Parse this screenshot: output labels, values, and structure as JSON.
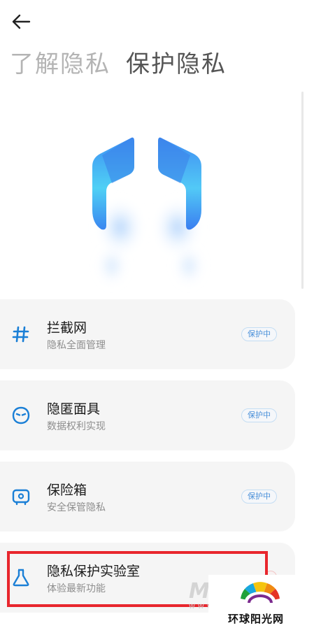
{
  "header": {
    "back_icon": "arrow-left-icon"
  },
  "tabs": [
    {
      "label": "了解隐私",
      "active": false
    },
    {
      "label": "保护隐私",
      "active": true
    }
  ],
  "hero": {
    "illustration": "privacy-shield-illustration"
  },
  "cards": [
    {
      "icon": "hash-icon",
      "title": "拦截网",
      "subtitle": "隐私全面管理",
      "badge": "保护中"
    },
    {
      "icon": "mask-icon",
      "title": "隐匿面具",
      "subtitle": "数据权利实现",
      "badge": "保护中"
    },
    {
      "icon": "safe-box-icon",
      "title": "保险箱",
      "subtitle": "安全保管隐私",
      "badge": "保护中"
    },
    {
      "icon": "flask-icon",
      "title": "隐私保护实验室",
      "subtitle": "体验最新功能",
      "badge": ""
    }
  ],
  "colors": {
    "accent": "#1a7fd6",
    "badge_text": "#4a90d9",
    "highlight": "#e8262d",
    "card_bg": "#f5f5f5"
  },
  "watermark": {
    "text": "环球阳光网",
    "mark": "M",
    "sub": "WWW"
  }
}
